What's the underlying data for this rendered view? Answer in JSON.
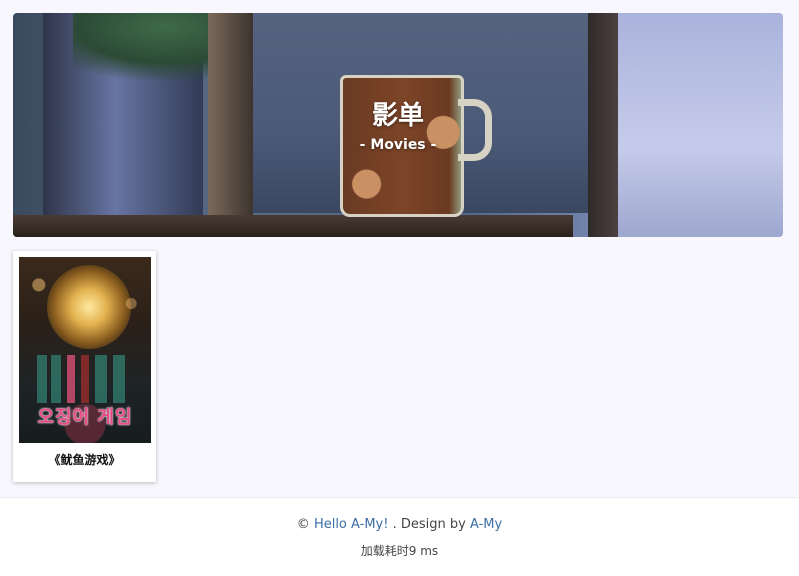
{
  "banner": {
    "title": "影单",
    "subtitle": "- Movies -"
  },
  "movies": [
    {
      "title": "《鱿鱼游戏》",
      "poster_logo": "오징어 게임"
    }
  ],
  "footer": {
    "copyright_symbol": "©",
    "hello_link": "Hello A-My!",
    "separator": ". Design by",
    "author_link": "A-My",
    "load_time": "加载耗时9 ms"
  },
  "colors": {
    "page_background": "#f7f7fd",
    "link": "#3b6ea5",
    "footer_text": "#444444"
  }
}
